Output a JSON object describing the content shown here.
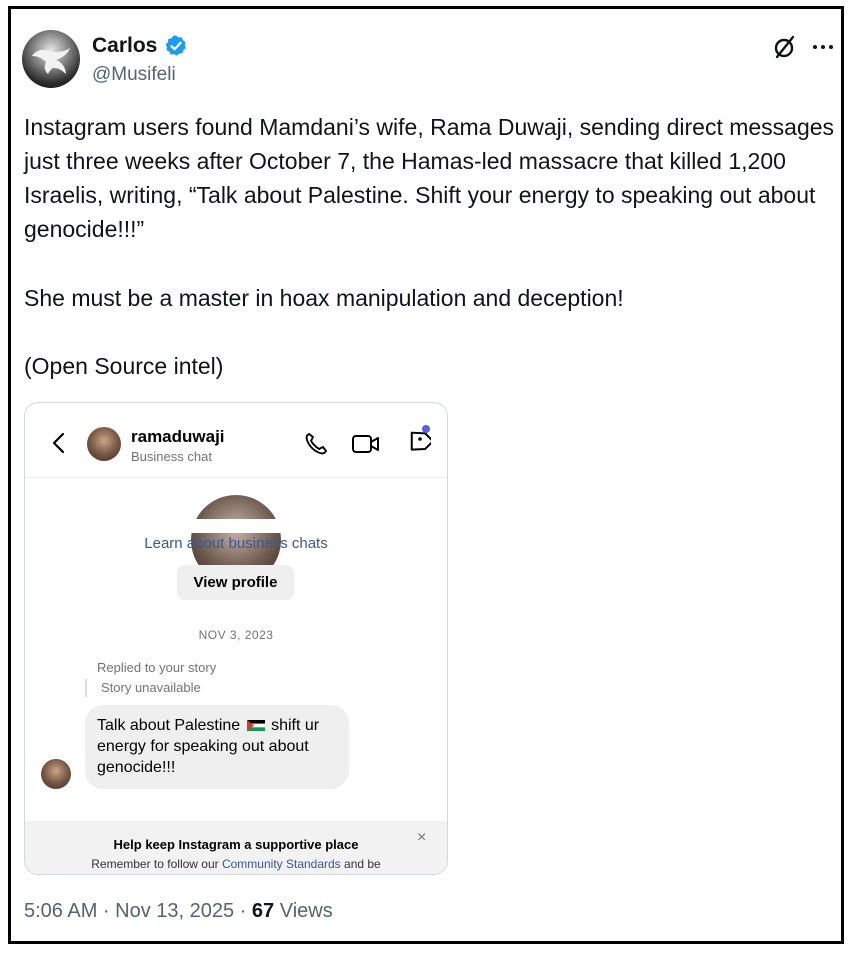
{
  "tweet": {
    "author_name": "Carlos",
    "author_handle": "@Musifeli",
    "verified": true,
    "paragraphs": [
      "Instagram users found Mamdani’s wife, Rama Duwaji, sending direct messages just three weeks after October 7,  the Hamas-led massacre that killed 1,200 Israelis, writing, “Talk about Palestine. Shift your energy to speaking out about genocide!!!”",
      "She must be a master in hoax manipulation and deception!",
      "(Open Source intel)"
    ],
    "timestamp": "5:06 AM · Nov 13, 2025 · ",
    "views_count": "67",
    "views_label": " Views"
  },
  "embed": {
    "username": "ramaduwaji",
    "subtitle": "Business chat",
    "learn_link": "Learn about business chats",
    "view_profile": "View profile",
    "date": "NOV 3, 2023",
    "replied": "Replied to your story",
    "story_unavailable": "Story unavailable",
    "message_part1": "Talk about Palestine ",
    "message_part2": " shift ur energy for speaking out about genocide!!!",
    "banner_title": "Help keep Instagram a supportive place",
    "banner_sub_pre": "Remember to follow our ",
    "banner_sub_link": "Community Standards",
    "banner_sub_post": " and be",
    "close_glyph": "×"
  },
  "icons": {
    "verified": "verified-badge-icon",
    "grok": "grok-icon",
    "more": "more-icon"
  },
  "colors": {
    "verified_blue": "#1d9bf0",
    "text_secondary": "#536471",
    "link_blue": "#385898",
    "notification_dot": "#5b5bf0"
  }
}
